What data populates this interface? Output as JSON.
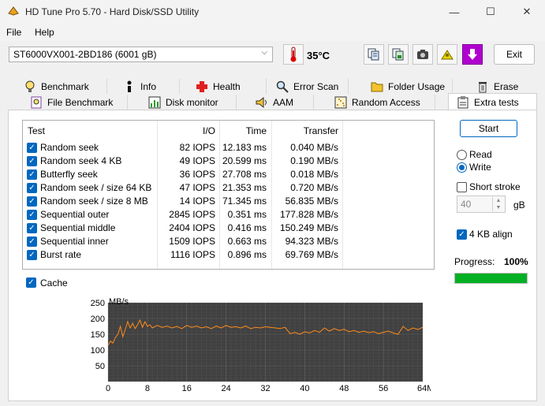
{
  "window": {
    "title": "HD Tune Pro 5.70 - Hard Disk/SSD Utility",
    "minimize": "—",
    "maximize": "☐",
    "close": "✕"
  },
  "menu": {
    "file": "File",
    "help": "Help"
  },
  "toolbar": {
    "drive": "ST6000VX001-2BD186 (6001 gB)",
    "temperature": "35°C",
    "exit_label": "Exit"
  },
  "tabs_row1": [
    {
      "label": "Benchmark",
      "icon": "lightbulb-icon"
    },
    {
      "label": "Info",
      "icon": "info-icon"
    },
    {
      "label": "Health",
      "icon": "red-cross-icon"
    },
    {
      "label": "Error Scan",
      "icon": "magnifier-icon"
    },
    {
      "label": "Folder Usage",
      "icon": "folder-icon"
    },
    {
      "label": "Erase",
      "icon": "trash-icon"
    }
  ],
  "tabs_row2": [
    {
      "label": "File Benchmark",
      "icon": "file-bulb-icon"
    },
    {
      "label": "Disk monitor",
      "icon": "monitor-chart-icon"
    },
    {
      "label": "AAM",
      "icon": "speaker-icon"
    },
    {
      "label": "Random Access",
      "icon": "scatter-icon"
    },
    {
      "label": "Extra tests",
      "icon": "extra-tests-icon",
      "active": true
    }
  ],
  "table": {
    "headers": {
      "test": "Test",
      "io": "I/O",
      "time": "Time",
      "transfer": "Transfer"
    },
    "rows": [
      {
        "test": "Random seek",
        "io": "82 IOPS",
        "time": "12.183 ms",
        "transfer": "0.040 MB/s"
      },
      {
        "test": "Random seek 4 KB",
        "io": "49 IOPS",
        "time": "20.599 ms",
        "transfer": "0.190 MB/s"
      },
      {
        "test": "Butterfly seek",
        "io": "36 IOPS",
        "time": "27.708 ms",
        "transfer": "0.018 MB/s"
      },
      {
        "test": "Random seek / size 64 KB",
        "io": "47 IOPS",
        "time": "21.353 ms",
        "transfer": "0.720 MB/s"
      },
      {
        "test": "Random seek / size 8 MB",
        "io": "14 IOPS",
        "time": "71.345 ms",
        "transfer": "56.835 MB/s"
      },
      {
        "test": "Sequential outer",
        "io": "2845 IOPS",
        "time": "0.351 ms",
        "transfer": "177.828 MB/s"
      },
      {
        "test": "Sequential middle",
        "io": "2404 IOPS",
        "time": "0.416 ms",
        "transfer": "150.249 MB/s"
      },
      {
        "test": "Sequential inner",
        "io": "1509 IOPS",
        "time": "0.663 ms",
        "transfer": "94.323 MB/s"
      },
      {
        "test": "Burst rate",
        "io": "1116 IOPS",
        "time": "0.896 ms",
        "transfer": "69.769 MB/s"
      }
    ]
  },
  "cache_label": "Cache",
  "controls": {
    "start_label": "Start",
    "read_label": "Read",
    "write_label": "Write",
    "mode_selected": "Write",
    "short_stroke_label": "Short stroke",
    "short_stroke_value": "40",
    "short_stroke_unit": "gB",
    "align_label": "4 KB align",
    "progress_label": "Progress:",
    "progress_value": "100%",
    "progress_fraction": 1.0
  },
  "colors": {
    "accent": "#0067c0",
    "progress": "#06b025",
    "chart_bg": "#404040",
    "chart_line": "#ff8c1a"
  },
  "chart_data": {
    "type": "line",
    "ylabel": "MB/s",
    "xlabel_unit": "MB",
    "ylim": [
      0,
      250
    ],
    "xlim": [
      0,
      64
    ],
    "yticks": [
      50,
      100,
      150,
      200,
      250
    ],
    "xticks": [
      0,
      8,
      16,
      24,
      32,
      40,
      48,
      56,
      64
    ],
    "xtick_labels": [
      "0",
      "8",
      "16",
      "24",
      "32",
      "40",
      "48",
      "56",
      "64MB"
    ],
    "grid": true,
    "series": [
      {
        "x": [
          0,
          0.5,
          1,
          1.5,
          2,
          2.5,
          3,
          3.5,
          4,
          4.5,
          5,
          5.5,
          6,
          6.5,
          7,
          7.5,
          8,
          8.5,
          9,
          10,
          11,
          12,
          13,
          14,
          15,
          16,
          17,
          18,
          19,
          20,
          21,
          22,
          23,
          24,
          25,
          26,
          27,
          28,
          29,
          30,
          31,
          32,
          33,
          34,
          35,
          36,
          37,
          38,
          39,
          40,
          41,
          42,
          43,
          44,
          45,
          46,
          47,
          48,
          49,
          50,
          51,
          52,
          53,
          54,
          55,
          56,
          57,
          58,
          59,
          60,
          61,
          62,
          63,
          64
        ],
        "values": [
          115,
          128,
          122,
          140,
          150,
          175,
          142,
          165,
          190,
          170,
          185,
          168,
          180,
          195,
          172,
          190,
          175,
          180,
          170,
          178,
          172,
          176,
          170,
          175,
          168,
          178,
          172,
          176,
          170,
          174,
          168,
          176,
          170,
          178,
          172,
          174,
          170,
          176,
          168,
          172,
          170,
          174,
          172,
          170,
          168,
          172,
          152,
          156,
          150,
          158,
          154,
          162,
          156,
          170,
          160,
          168,
          162,
          166,
          158,
          162,
          156,
          160,
          155,
          158,
          152,
          156,
          160,
          154,
          150,
          175,
          162,
          170,
          165,
          172
        ]
      }
    ]
  }
}
